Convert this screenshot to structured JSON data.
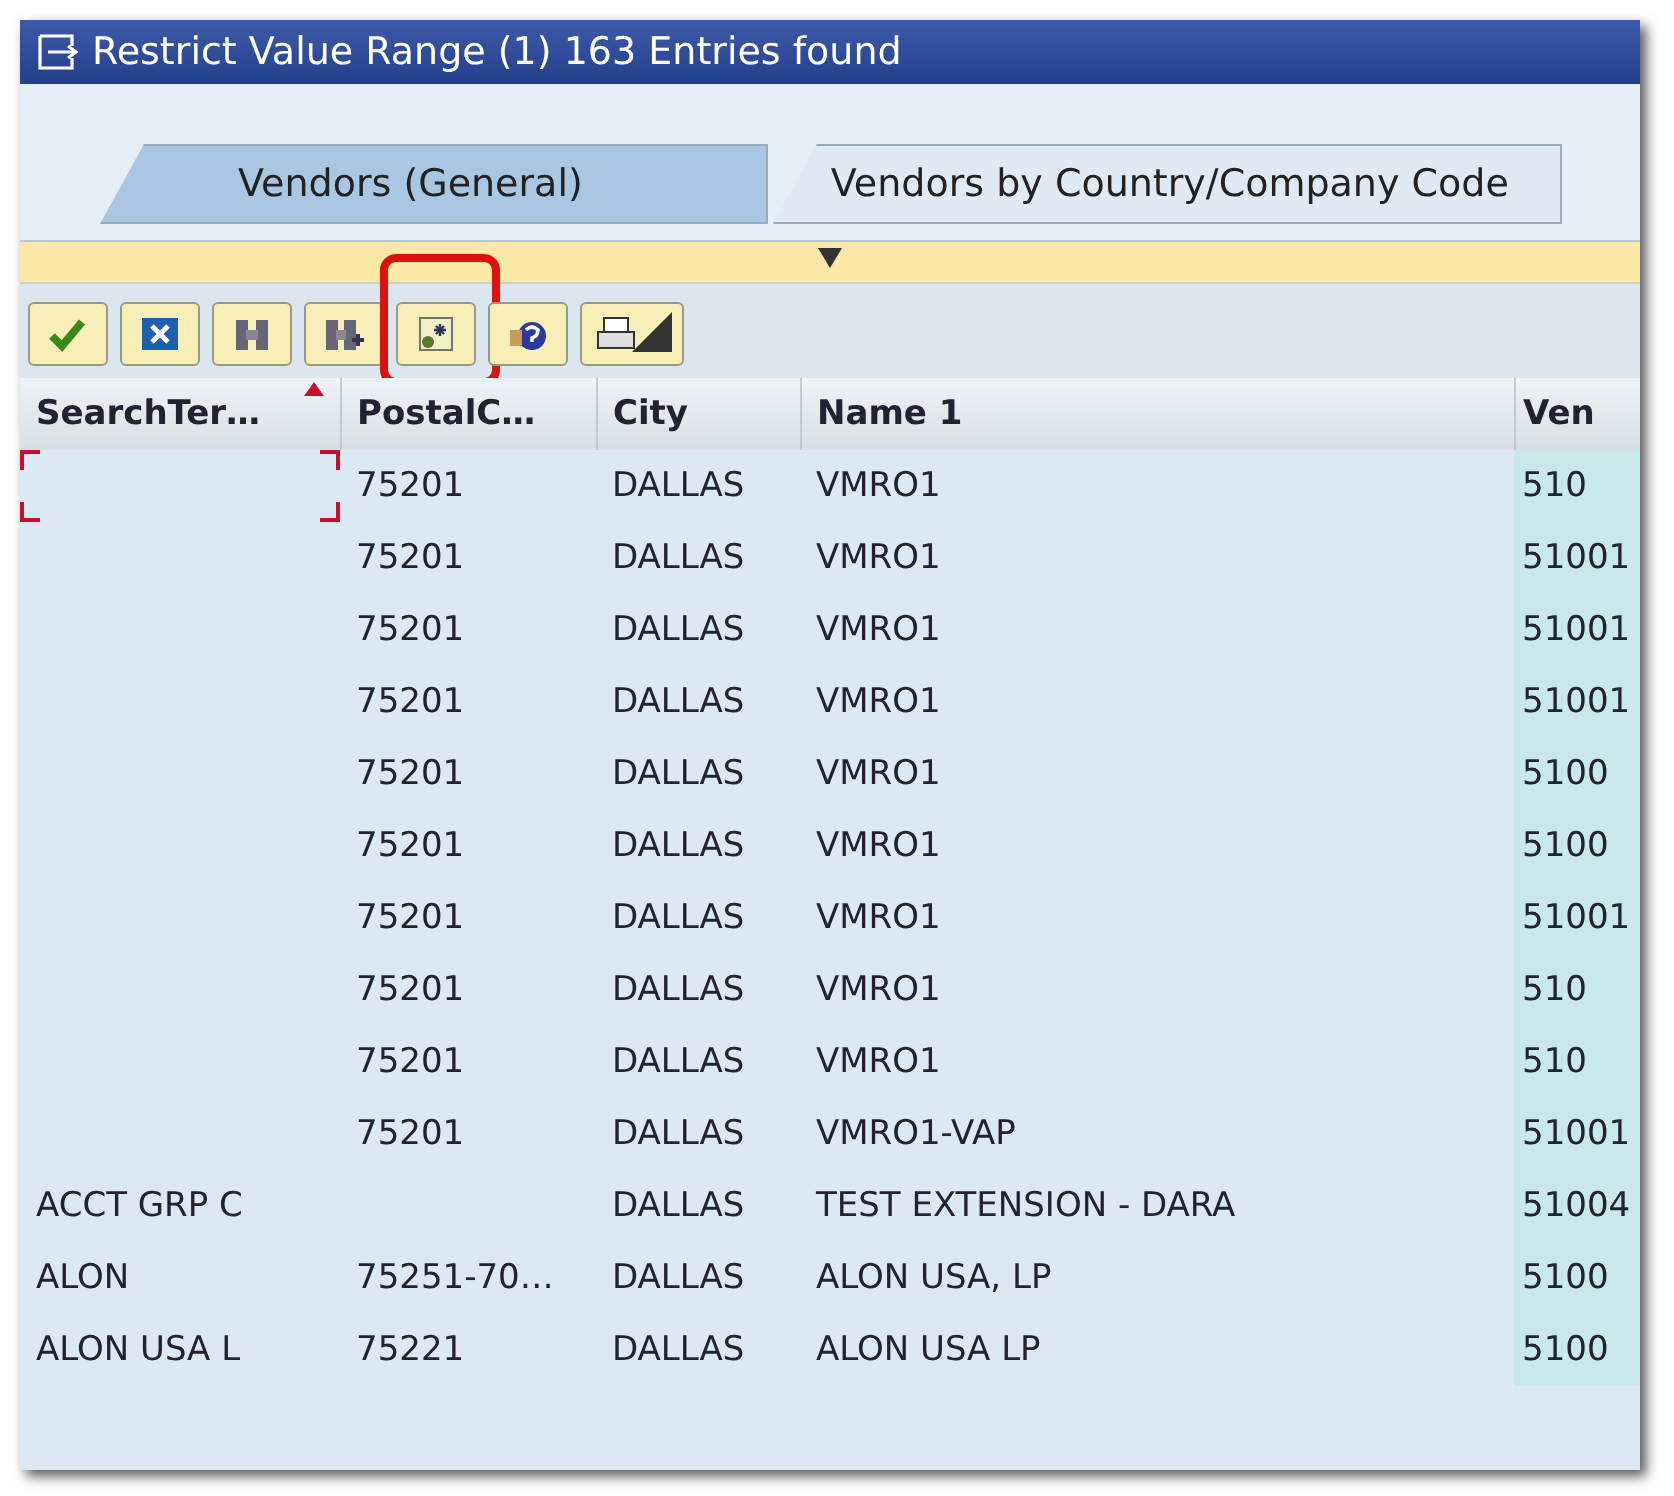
{
  "window": {
    "title": "Restrict Value Range (1)  163 Entries found"
  },
  "tabs": [
    {
      "label": "Vendors (General)",
      "selected": true
    },
    {
      "label": "Vendors by Country/Company Code",
      "selected": false
    }
  ],
  "toolbar": [
    {
      "kind": "check",
      "highlighted": false,
      "dropdown": false
    },
    {
      "kind": "cancel",
      "highlighted": false,
      "dropdown": false
    },
    {
      "kind": "find",
      "highlighted": false,
      "dropdown": false
    },
    {
      "kind": "find-next",
      "highlighted": false,
      "dropdown": false
    },
    {
      "kind": "new-entry",
      "highlighted": true,
      "dropdown": false
    },
    {
      "kind": "help",
      "highlighted": false,
      "dropdown": false
    },
    {
      "kind": "print",
      "highlighted": false,
      "dropdown": true
    }
  ],
  "table": {
    "columns": [
      {
        "label": "SearchTer…",
        "sorted": true
      },
      {
        "label": "PostalC…",
        "sorted": false
      },
      {
        "label": "City",
        "sorted": false
      },
      {
        "label": "Name 1",
        "sorted": false
      },
      {
        "label": "Ven",
        "sorted": false
      }
    ],
    "rows": [
      {
        "focused": true,
        "cells": [
          "",
          "75201",
          "DALLAS",
          "VMRO1",
          "510"
        ]
      },
      {
        "focused": false,
        "cells": [
          "",
          "75201",
          "DALLAS",
          "VMRO1",
          "51001"
        ]
      },
      {
        "focused": false,
        "cells": [
          "",
          "75201",
          "DALLAS",
          "VMRO1",
          "51001"
        ]
      },
      {
        "focused": false,
        "cells": [
          "",
          "75201",
          "DALLAS",
          "VMRO1",
          "51001"
        ]
      },
      {
        "focused": false,
        "cells": [
          "",
          "75201",
          "DALLAS",
          "VMRO1",
          "5100"
        ]
      },
      {
        "focused": false,
        "cells": [
          "",
          "75201",
          "DALLAS",
          "VMRO1",
          "5100"
        ]
      },
      {
        "focused": false,
        "cells": [
          "",
          "75201",
          "DALLAS",
          "VMRO1",
          "51001"
        ]
      },
      {
        "focused": false,
        "cells": [
          "",
          "75201",
          "DALLAS",
          "VMRO1",
          "510"
        ]
      },
      {
        "focused": false,
        "cells": [
          "",
          "75201",
          "DALLAS",
          "VMRO1",
          "510"
        ]
      },
      {
        "focused": false,
        "cells": [
          "",
          "75201",
          "DALLAS",
          "VMRO1-VAP",
          "51001"
        ]
      },
      {
        "focused": false,
        "cells": [
          "ACCT GRP C",
          "",
          "DALLAS",
          "TEST EXTENSION - DARA",
          "51004"
        ]
      },
      {
        "focused": false,
        "cells": [
          "ALON",
          "75251-70…",
          "DALLAS",
          "ALON USA, LP",
          "5100"
        ]
      },
      {
        "focused": false,
        "cells": [
          "ALON USA L",
          "75221",
          "DALLAS",
          "ALON USA LP",
          "5100"
        ]
      }
    ]
  }
}
